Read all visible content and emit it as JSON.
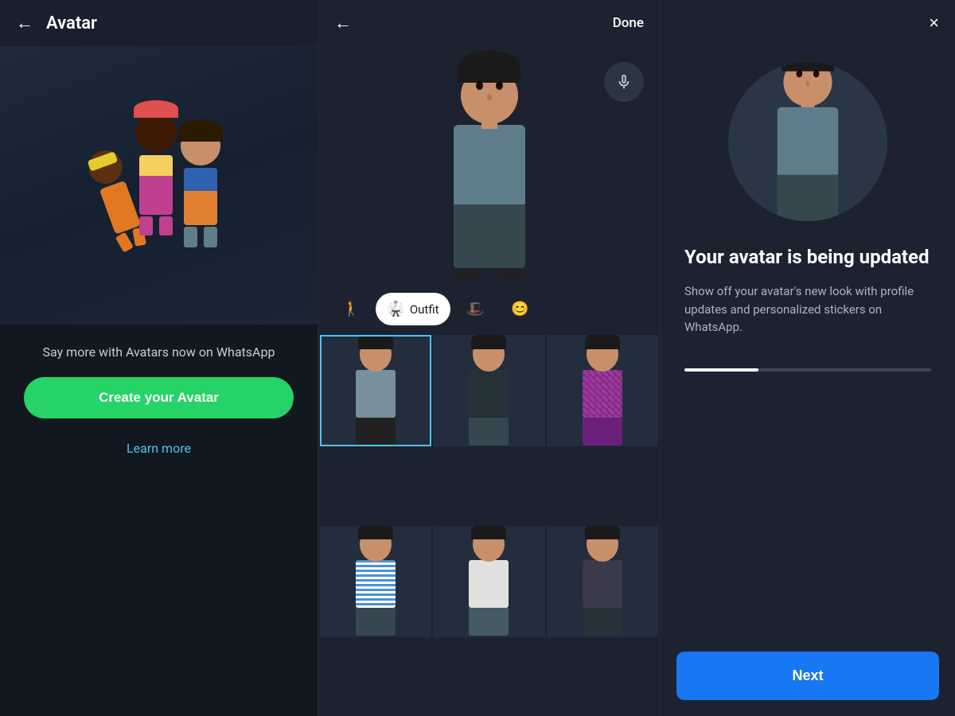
{
  "panel1": {
    "header": {
      "back_label": "←",
      "title": "Avatar"
    },
    "tagline": "Say more with Avatars now on WhatsApp",
    "create_button": "Create your Avatar",
    "learn_more": "Learn more"
  },
  "panel2": {
    "header": {
      "back_label": "←",
      "done_label": "Done"
    },
    "tabs": [
      {
        "id": "body",
        "icon": "🚶",
        "label": ""
      },
      {
        "id": "outfit",
        "icon": "🥋",
        "label": "Outfit",
        "active": true
      },
      {
        "id": "hat",
        "icon": "🎩",
        "label": ""
      },
      {
        "id": "face",
        "icon": "😊",
        "label": ""
      }
    ],
    "outfits": [
      {
        "id": 1,
        "color": "gray",
        "selected": true
      },
      {
        "id": 2,
        "color": "black"
      },
      {
        "id": 3,
        "color": "plaid"
      },
      {
        "id": 4,
        "color": "blue-stripe"
      },
      {
        "id": 5,
        "color": "white"
      },
      {
        "id": 6,
        "color": "jacket"
      }
    ]
  },
  "panel3": {
    "close_label": "×",
    "update_title": "Your avatar is being updated",
    "update_description": "Show off your avatar's new look with profile updates and personalized stickers on WhatsApp.",
    "progress": 30,
    "next_button": "Next"
  }
}
